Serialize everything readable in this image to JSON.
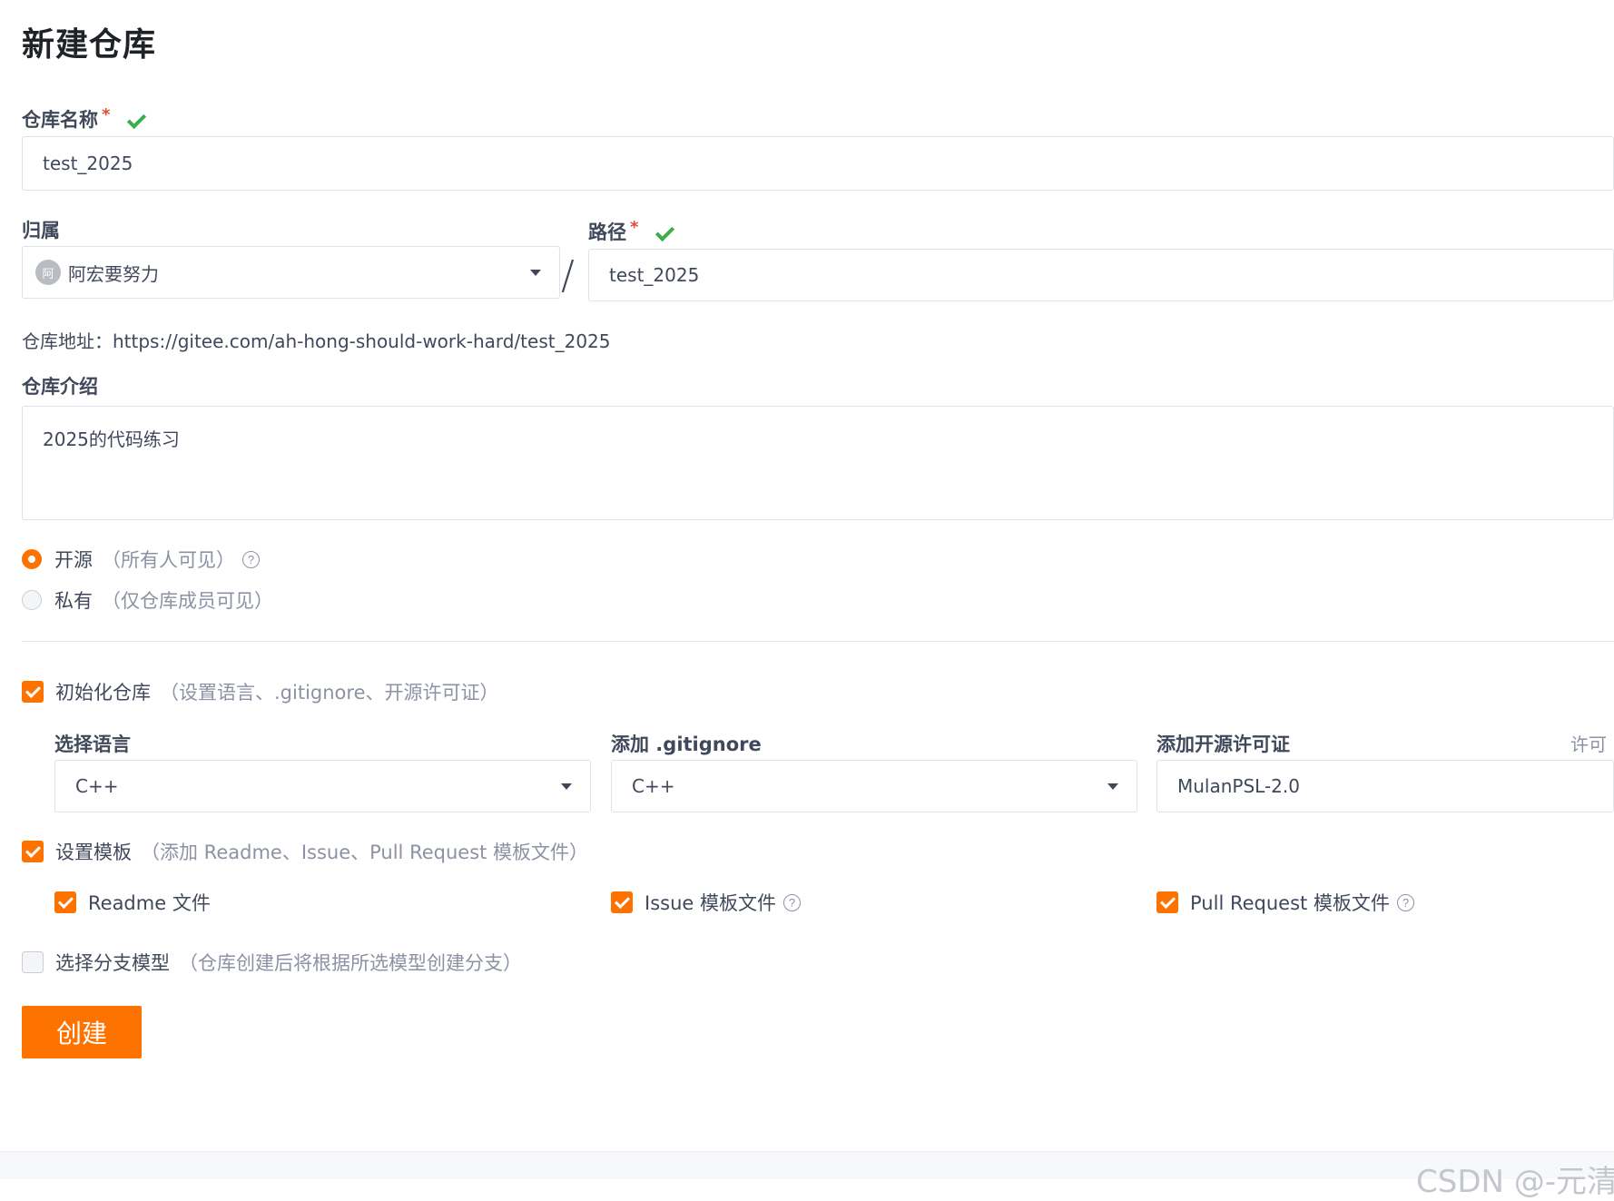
{
  "page": {
    "title": "新建仓库"
  },
  "repo_name": {
    "label": "仓库名称",
    "required": "*",
    "value": "test_2025"
  },
  "owner": {
    "label": "归属",
    "avatar_text": "阿",
    "value": "阿宏要努力"
  },
  "path": {
    "label": "路径",
    "required": "*",
    "separator": "/",
    "value": "test_2025"
  },
  "repo_url": {
    "label": "仓库地址：",
    "value": "https://gitee.com/ah-hong-should-work-hard/test_2025"
  },
  "description": {
    "label": "仓库介绍",
    "value": "2025的代码练习"
  },
  "visibility": {
    "options": [
      {
        "label": "开源",
        "hint": "（所有人可见）",
        "selected": true
      },
      {
        "label": "私有",
        "hint": "（仅仓库成员可见）",
        "selected": false
      }
    ]
  },
  "init_repo": {
    "label": "初始化仓库",
    "hint": "（设置语言、.gitignore、开源许可证）",
    "checked": true,
    "language": {
      "label": "选择语言",
      "value": "C++"
    },
    "gitignore": {
      "label": "添加 .gitignore",
      "value": "C++"
    },
    "license": {
      "label": "添加开源许可证",
      "value": "MulanPSL-2.0",
      "side_hint": "许可"
    }
  },
  "template": {
    "label": "设置模板",
    "hint": "（添加 Readme、Issue、Pull Request 模板文件）",
    "checked": true,
    "items": [
      {
        "label": "Readme 文件",
        "checked": true
      },
      {
        "label": "Issue 模板文件",
        "checked": true
      },
      {
        "label": "Pull Request 模板文件",
        "checked": true
      }
    ]
  },
  "branch_model": {
    "label": "选择分支模型",
    "hint": "（仓库创建后将根据所选模型创建分支）",
    "checked": false
  },
  "actions": {
    "create_label": "创建"
  },
  "watermark": {
    "text": "CSDN @-元清-"
  },
  "colors": {
    "accent": "#fe7300",
    "success": "#3cae49",
    "required": "#e5483b"
  }
}
